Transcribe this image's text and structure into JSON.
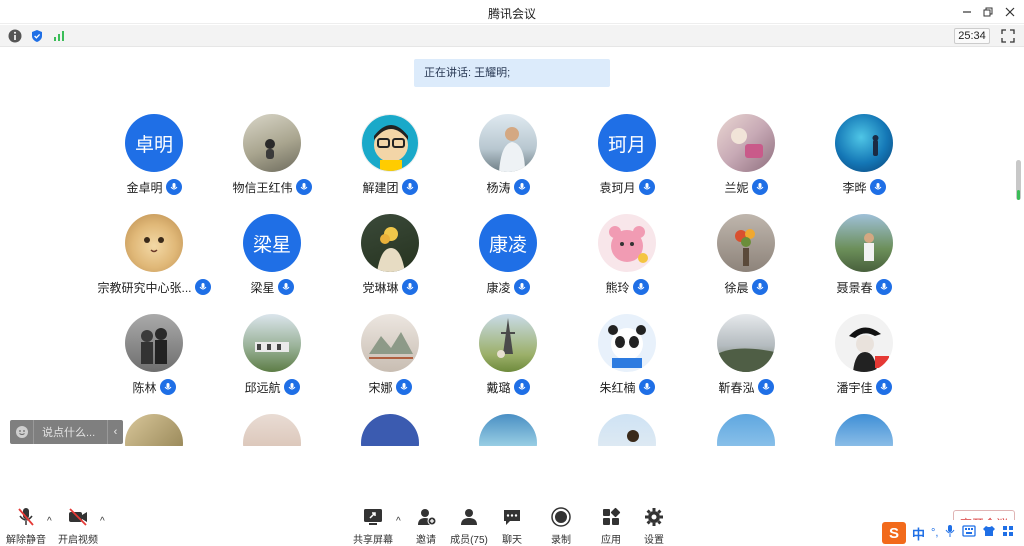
{
  "window": {
    "title": "腾讯会议"
  },
  "infobar": {
    "timer": "25:34"
  },
  "speaking": {
    "label": "正在讲话: 王耀明;"
  },
  "participants": [
    {
      "name": "金卓明",
      "avatar_text": "卓明"
    },
    {
      "name": "物信王红伟",
      "avatar_text": ""
    },
    {
      "name": "解建团",
      "avatar_text": ""
    },
    {
      "name": "杨涛",
      "avatar_text": ""
    },
    {
      "name": "袁珂月",
      "avatar_text": "珂月"
    },
    {
      "name": "兰妮",
      "avatar_text": ""
    },
    {
      "name": "李晔",
      "avatar_text": ""
    },
    {
      "name": "宗教研究中心张...",
      "avatar_text": ""
    },
    {
      "name": "梁星",
      "avatar_text": "梁星"
    },
    {
      "name": "党琳琳",
      "avatar_text": ""
    },
    {
      "name": "康凌",
      "avatar_text": "康凌"
    },
    {
      "name": "熊玲",
      "avatar_text": ""
    },
    {
      "name": "徐晨",
      "avatar_text": ""
    },
    {
      "name": "聂景春",
      "avatar_text": ""
    },
    {
      "name": "陈林",
      "avatar_text": ""
    },
    {
      "name": "邱远航",
      "avatar_text": ""
    },
    {
      "name": "宋娜",
      "avatar_text": ""
    },
    {
      "name": "戴璐",
      "avatar_text": ""
    },
    {
      "name": "朱红楠",
      "avatar_text": ""
    },
    {
      "name": "靳春泓",
      "avatar_text": ""
    },
    {
      "name": "潘宇佳",
      "avatar_text": ""
    }
  ],
  "chat": {
    "placeholder": "说点什么..."
  },
  "toolbar": {
    "unmute": "解除静音",
    "start_video": "开启视频",
    "share_screen": "共享屏幕",
    "invite": "邀请",
    "members": "成员(75)",
    "chat": "聊天",
    "record": "录制",
    "apps": "应用",
    "settings": "设置",
    "leave": "离开会议"
  },
  "ime": {
    "logo": "S",
    "lang": "中",
    "punct": "°,"
  },
  "colors": {
    "accent": "#1f6fe6",
    "banner": "#dcebfb",
    "leave": "#d83a3a"
  }
}
